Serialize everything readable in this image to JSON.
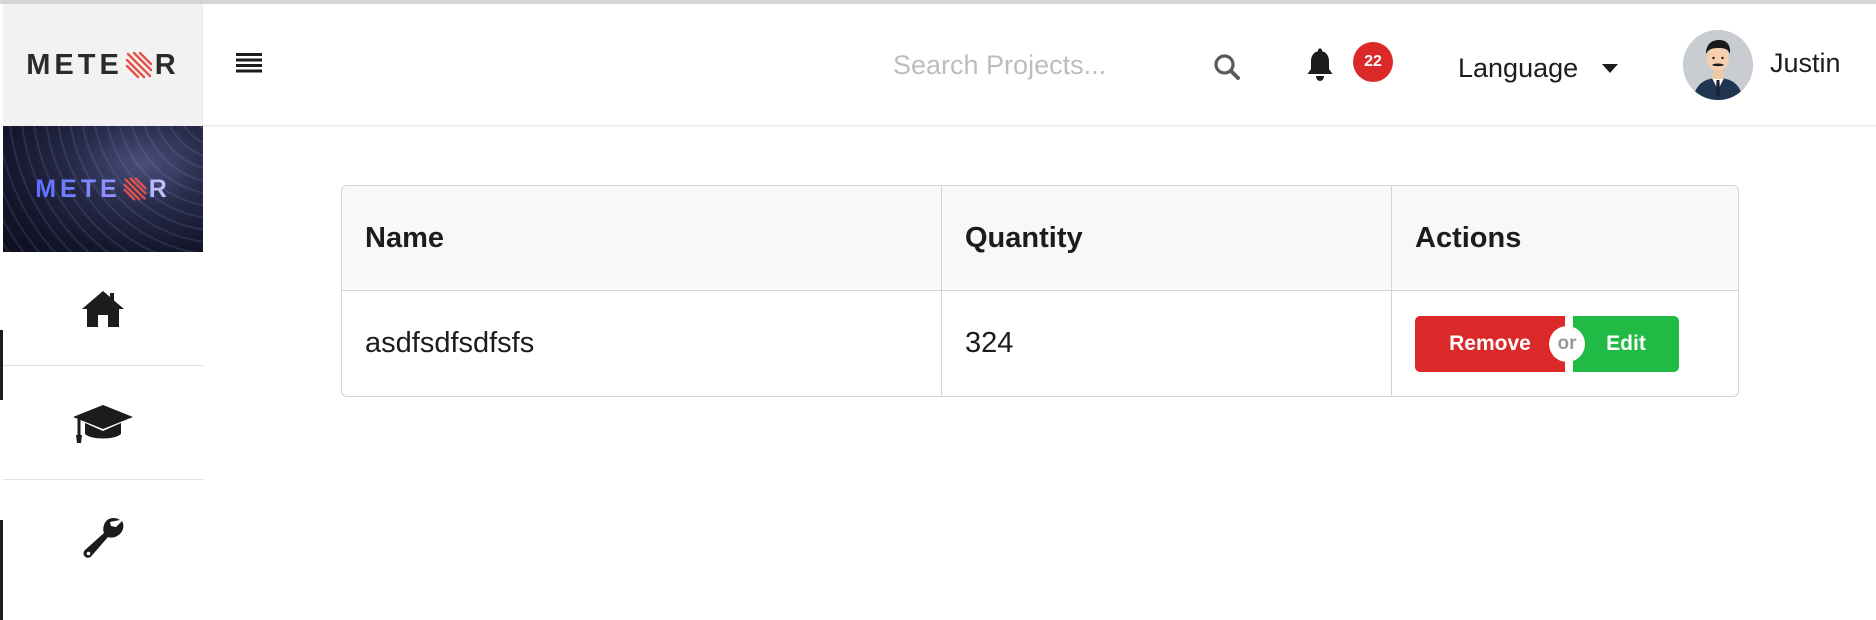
{
  "sidebar": {
    "logo_text_left": "METE",
    "logo_text_right": "R",
    "banner_text_left": "METE",
    "banner_text_right": "R",
    "nav_items": [
      {
        "icon": "home-icon"
      },
      {
        "icon": "graduation-cap-icon"
      },
      {
        "icon": "wrench-icon"
      }
    ]
  },
  "header": {
    "menu_icon": "list-icon",
    "search": {
      "placeholder": "Search Projects...",
      "value": ""
    },
    "notifications": {
      "count": "22"
    },
    "language_label": "Language",
    "user": {
      "name": "Justin"
    }
  },
  "table": {
    "columns": [
      "Name",
      "Quantity",
      "Actions"
    ],
    "rows": [
      {
        "name": "asdfsdfsdfsfs",
        "quantity": "324"
      }
    ],
    "actions": {
      "remove_label": "Remove",
      "or_label": "or",
      "edit_label": "Edit"
    }
  },
  "colors": {
    "remove": "#db2828",
    "edit": "#21ba45",
    "badge": "#db2828"
  }
}
